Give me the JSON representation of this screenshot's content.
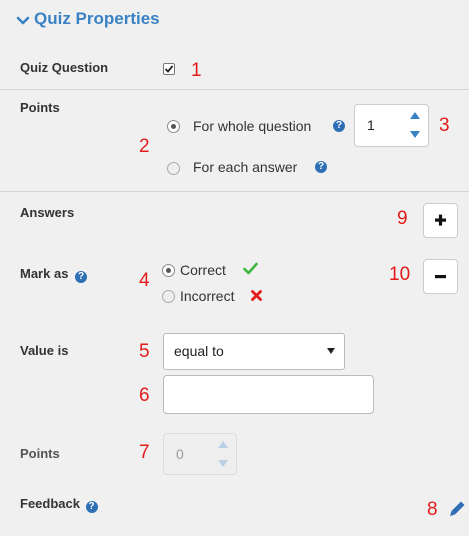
{
  "header": {
    "title": "Quiz Properties"
  },
  "quiz_question": {
    "label": "Quiz Question",
    "checked": true,
    "marker": "1"
  },
  "points_section": {
    "label": "Points",
    "option_whole": "For whole question",
    "option_each": "For each answer",
    "marker_radio": "2",
    "marker_spin": "3",
    "value": "1"
  },
  "answers": {
    "label": "Answers",
    "marker_add": "9",
    "marker_remove": "10"
  },
  "mark_as": {
    "label": "Mark as",
    "marker": "4",
    "option_correct": "Correct",
    "option_incorrect": "Incorrect"
  },
  "value_is": {
    "label": "Value is",
    "marker_select": "5",
    "selected": "equal to",
    "marker_input": "6",
    "input_value": ""
  },
  "answer_points": {
    "label": "Points",
    "marker": "7",
    "value": "0"
  },
  "feedback": {
    "label": "Feedback",
    "marker": "8"
  },
  "colors": {
    "accent": "#3a82c4",
    "annotation": "#e31b1b",
    "check": "#3cb53c",
    "cross": "#e31b1b",
    "help": "#2f6fb5"
  }
}
